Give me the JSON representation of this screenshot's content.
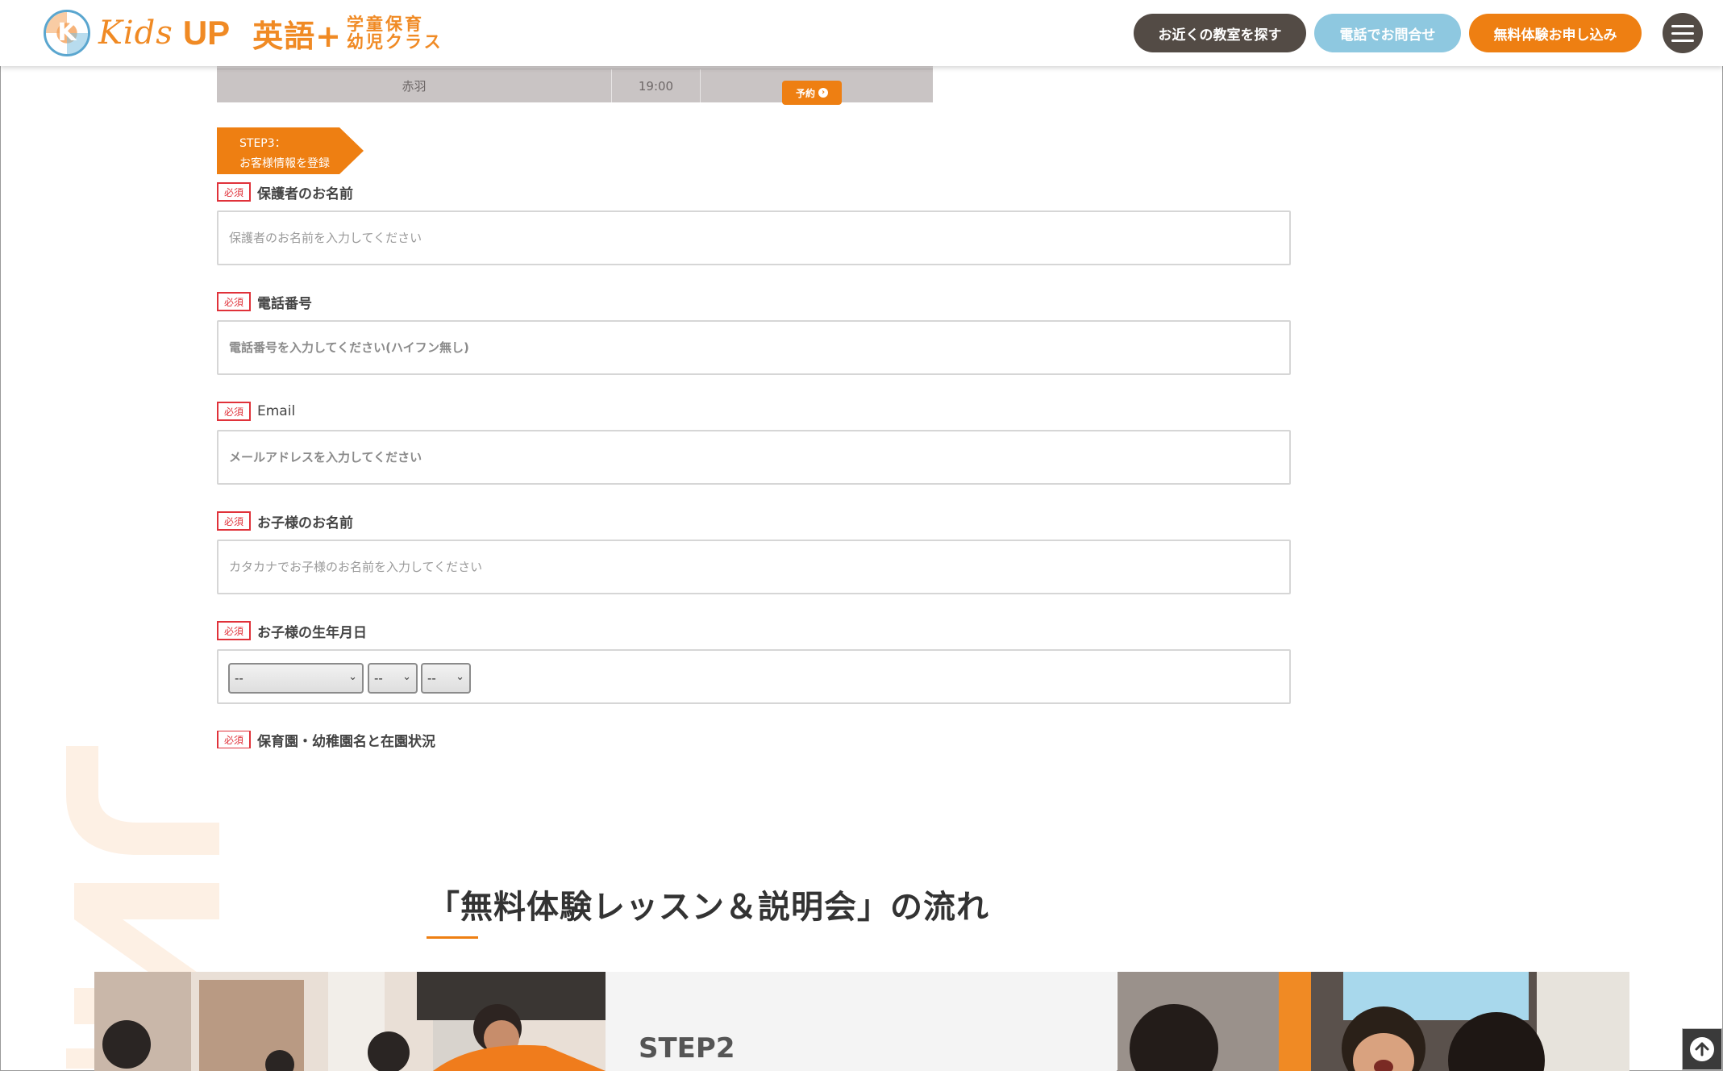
{
  "header": {
    "logo": {
      "mark_letter": "K",
      "kids": "Kids",
      "up": "UP",
      "eigo": "英語+",
      "sub_line1": "学童保育",
      "sub_line2": "幼児クラス"
    },
    "find_button": "お近くの教室を探す",
    "phone_button": "電話でお問合せ",
    "trial_button": "無料体験お申し込み",
    "menu_icon": "hamburger-menu-icon"
  },
  "schedule": {
    "row": {
      "location": "赤羽",
      "time": "19:00",
      "reserve_label": "予約"
    }
  },
  "step3": {
    "line1": "STEP3：",
    "line2": "お客様情報を登録"
  },
  "form": {
    "required_badge": "必須",
    "guardian_name": {
      "label": "保護者のお名前",
      "placeholder": "保護者のお名前を入力してください",
      "value": ""
    },
    "phone": {
      "label": "電話番号",
      "placeholder": "電話番号を入力してください(ハイフン無し)",
      "value": ""
    },
    "email": {
      "label": "Email",
      "placeholder": "メールアドレスを入力してください",
      "value": ""
    },
    "child_name": {
      "label": "お子様のお名前",
      "placeholder": "カタカナでお子様のお名前を入力してください",
      "value": ""
    },
    "child_birthdate": {
      "label": "お子様の生年月日",
      "year": "--",
      "month": "--",
      "day": "--"
    },
    "nursery": {
      "label": "保育園・幼稚園名と在園状況"
    }
  },
  "flow_section": {
    "title": "「無料体験レッスン＆説明会」の流れ",
    "step_label": "STEP2"
  },
  "colors": {
    "orange": "#ee7f12",
    "dark_brown": "#534b45",
    "light_blue": "#8ec8e0",
    "required_red": "#e0323a"
  }
}
